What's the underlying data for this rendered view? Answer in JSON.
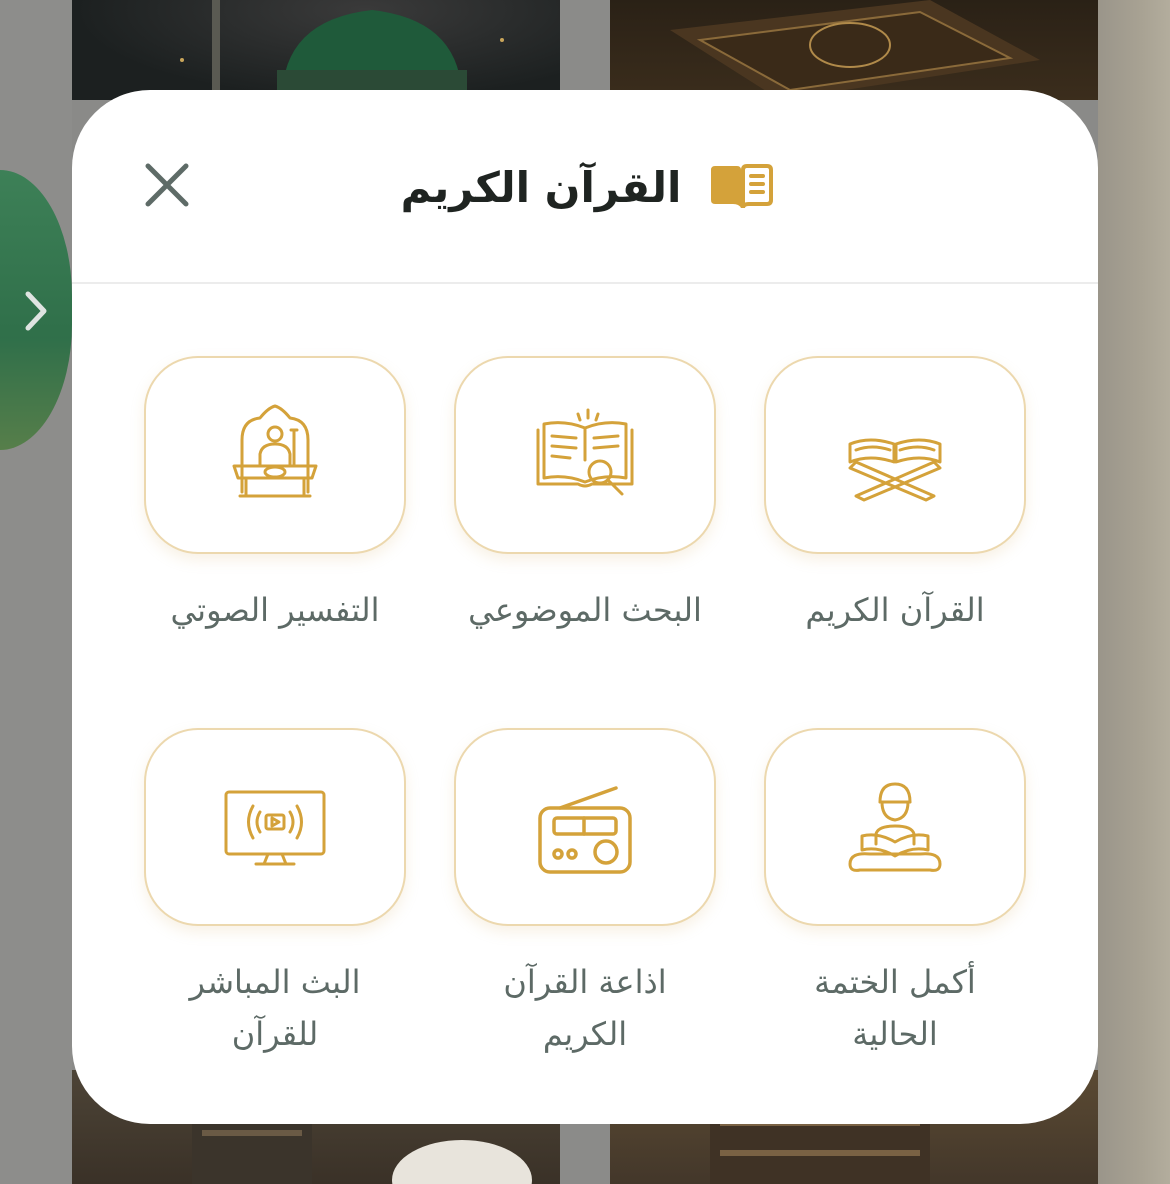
{
  "sheet": {
    "title": "القرآن الكريم",
    "title_icon": "open-book-icon",
    "close_icon": "close-icon"
  },
  "items": [
    {
      "label_lines": [
        "القرآن الكريم"
      ],
      "icon": "quran-stand-icon"
    },
    {
      "label_lines": [
        "البحث الموضوعي"
      ],
      "icon": "book-search-icon"
    },
    {
      "label_lines": [
        "التفسير الصوتي"
      ],
      "icon": "preacher-pulpit-icon"
    },
    {
      "label_lines": [
        "أكمل الختمة",
        "الحالية"
      ],
      "icon": "reading-person-icon"
    },
    {
      "label_lines": [
        "اذاعة القرآن",
        "الكريم"
      ],
      "icon": "radio-icon"
    },
    {
      "label_lines": [
        "البث المباشر",
        "للقرآن"
      ],
      "icon": "live-tv-icon"
    }
  ],
  "background": {
    "side_tab_icon": "chevron-right-icon"
  },
  "colors": {
    "accent_gold": "#D4A23A",
    "tile_border": "#ECD8AE",
    "label_text": "#5D6A66",
    "title_text": "#1F2421",
    "close_icon": "#5E6B67"
  }
}
